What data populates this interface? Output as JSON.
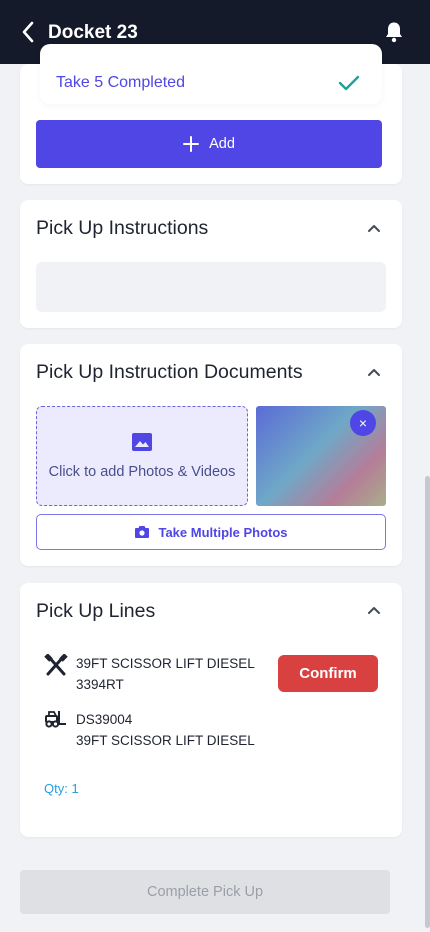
{
  "header": {
    "title": "Docket 23"
  },
  "take_section": {
    "completed_label": "Take 5 Completed",
    "add_label": "Add"
  },
  "instructions": {
    "title": "Pick Up Instructions",
    "value": ""
  },
  "documents": {
    "title": "Pick Up Instruction Documents",
    "upload_label": "Click to add Photos & Videos",
    "multi_photo_label": "Take Multiple Photos",
    "remove_symbol": "×"
  },
  "lines": {
    "title": "Pick Up Lines",
    "item": {
      "name": "39FT SCISSOR LIFT DIESEL",
      "code": "3394RT",
      "asset_id": "DS39004",
      "asset_name": "39FT SCISSOR LIFT DIESEL",
      "confirm_label": "Confirm",
      "qty": "Qty: 1"
    }
  },
  "footer": {
    "complete_label": "Complete Pick Up"
  },
  "colors": {
    "primary": "#4f46e5",
    "danger": "#d94141",
    "header": "#141a29",
    "check": "#1aa39a",
    "qty": "#2a9de0"
  }
}
